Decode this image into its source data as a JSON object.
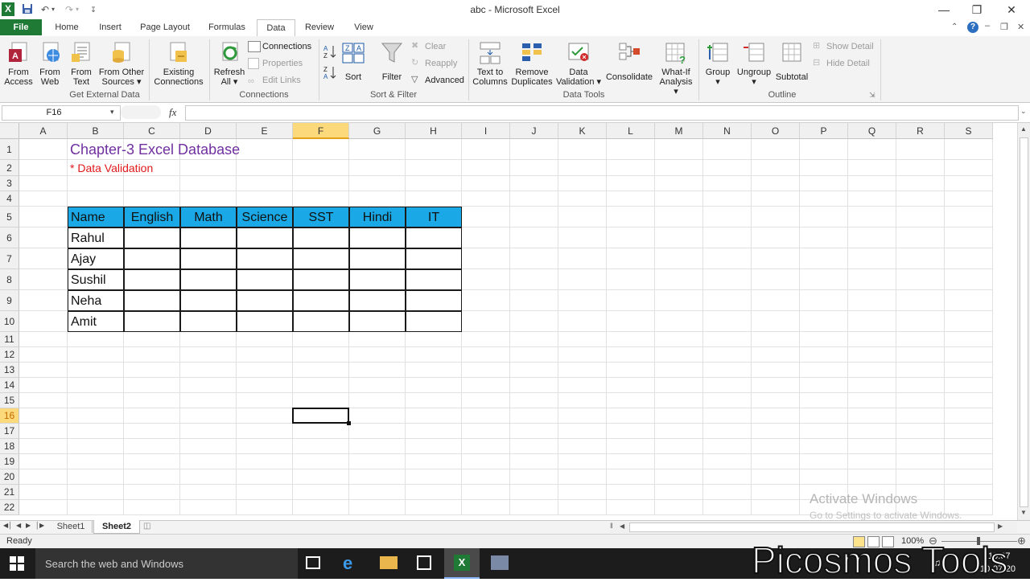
{
  "window": {
    "title": "abc - Microsoft Excel"
  },
  "tabs": [
    "File",
    "Home",
    "Insert",
    "Page Layout",
    "Formulas",
    "Data",
    "Review",
    "View"
  ],
  "active_tab": "Data",
  "ribbon": {
    "get_external": {
      "label": "Get External Data",
      "from_access": [
        "From",
        "Access"
      ],
      "from_web": [
        "From",
        "Web"
      ],
      "from_text": [
        "From",
        "Text"
      ],
      "from_other": [
        "From Other",
        "Sources ▾"
      ],
      "existing": [
        "Existing",
        "Connections"
      ]
    },
    "connections": {
      "label": "Connections",
      "refresh": [
        "Refresh",
        "All ▾"
      ],
      "connections": "Connections",
      "properties": "Properties",
      "edit_links": "Edit Links"
    },
    "sort_filter": {
      "label": "Sort & Filter",
      "sort": "Sort",
      "filter": "Filter",
      "clear": "Clear",
      "reapply": "Reapply",
      "advanced": "Advanced"
    },
    "data_tools": {
      "label": "Data Tools",
      "text_to_columns": [
        "Text to",
        "Columns"
      ],
      "remove_duplicates": [
        "Remove",
        "Duplicates"
      ],
      "data_validation": [
        "Data",
        "Validation ▾"
      ],
      "consolidate": "Consolidate",
      "what_if": [
        "What-If",
        "Analysis ▾"
      ]
    },
    "outline": {
      "label": "Outline",
      "group": [
        "Group",
        "▾"
      ],
      "ungroup": [
        "Ungroup",
        "▾"
      ],
      "subtotal": "Subtotal",
      "show_detail": "Show Detail",
      "hide_detail": "Hide Detail"
    }
  },
  "formula_bar": {
    "name_box": "F16",
    "fx": "fx",
    "value": ""
  },
  "columns": [
    "A",
    "B",
    "C",
    "D",
    "E",
    "F",
    "G",
    "H",
    "I",
    "J",
    "K",
    "L",
    "M",
    "N",
    "O",
    "P",
    "Q",
    "R",
    "S"
  ],
  "selected_column": "F",
  "rows": [
    "1",
    "2",
    "3",
    "4",
    "5",
    "6",
    "7",
    "8",
    "9",
    "10",
    "11",
    "12",
    "13",
    "14",
    "15",
    "16",
    "17",
    "18",
    "19",
    "20",
    "21",
    "22"
  ],
  "selected_row": "16",
  "sheet": {
    "title": "Chapter-3 Excel Database",
    "subtitle": "* Data Validation",
    "table_headers": [
      "Name",
      "English",
      "Math",
      "Science",
      "SST",
      "Hindi",
      "IT"
    ],
    "table_rows": [
      "Rahul",
      "Ajay",
      "Sushil",
      "Neha",
      "Amit"
    ],
    "header_color": "#1aa9e6",
    "title_color": "#7030a0",
    "subtitle_color": "#e0181b"
  },
  "watermark": {
    "line1": "Activate Windows",
    "line2": "Go to Settings to activate Windows."
  },
  "sheet_tabs": [
    "Sheet1",
    "Sheet2"
  ],
  "active_sheet": "Sheet2",
  "status": {
    "ready": "Ready",
    "zoom": "100%"
  },
  "taskbar": {
    "search": "Search the web and Windows",
    "time": "10:07",
    "date": "10-07-20"
  },
  "brand_overlay": "Picosmos Tools"
}
